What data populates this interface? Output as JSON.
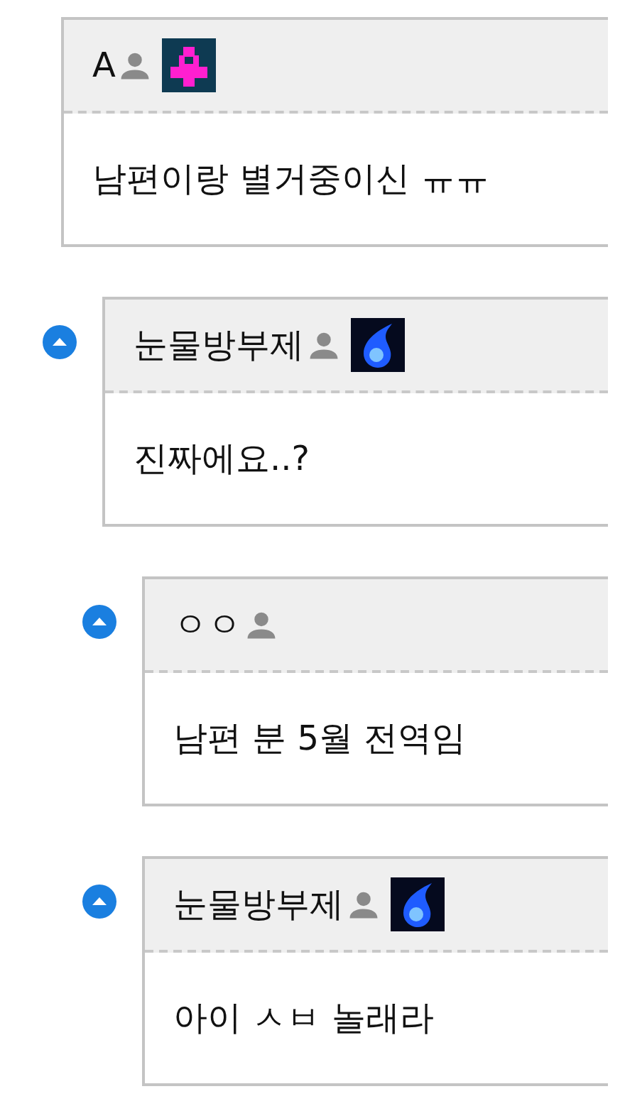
{
  "comments": [
    {
      "author": "A",
      "emblem": {
        "kind": "pixel"
      },
      "text": "남편이랑 별거중이신 ㅠㅠ",
      "children": [
        {
          "author": "눈물방부제",
          "emblem": {
            "kind": "flame"
          },
          "text": "진짜에요..?",
          "children": [
            {
              "author": "ㅇㅇ",
              "text": "남편 분 5월 전역임"
            },
            {
              "author": "눈물방부제",
              "emblem": {
                "kind": "flame"
              },
              "text": "아이 ㅅㅂ 놀래라"
            }
          ]
        }
      ]
    }
  ]
}
